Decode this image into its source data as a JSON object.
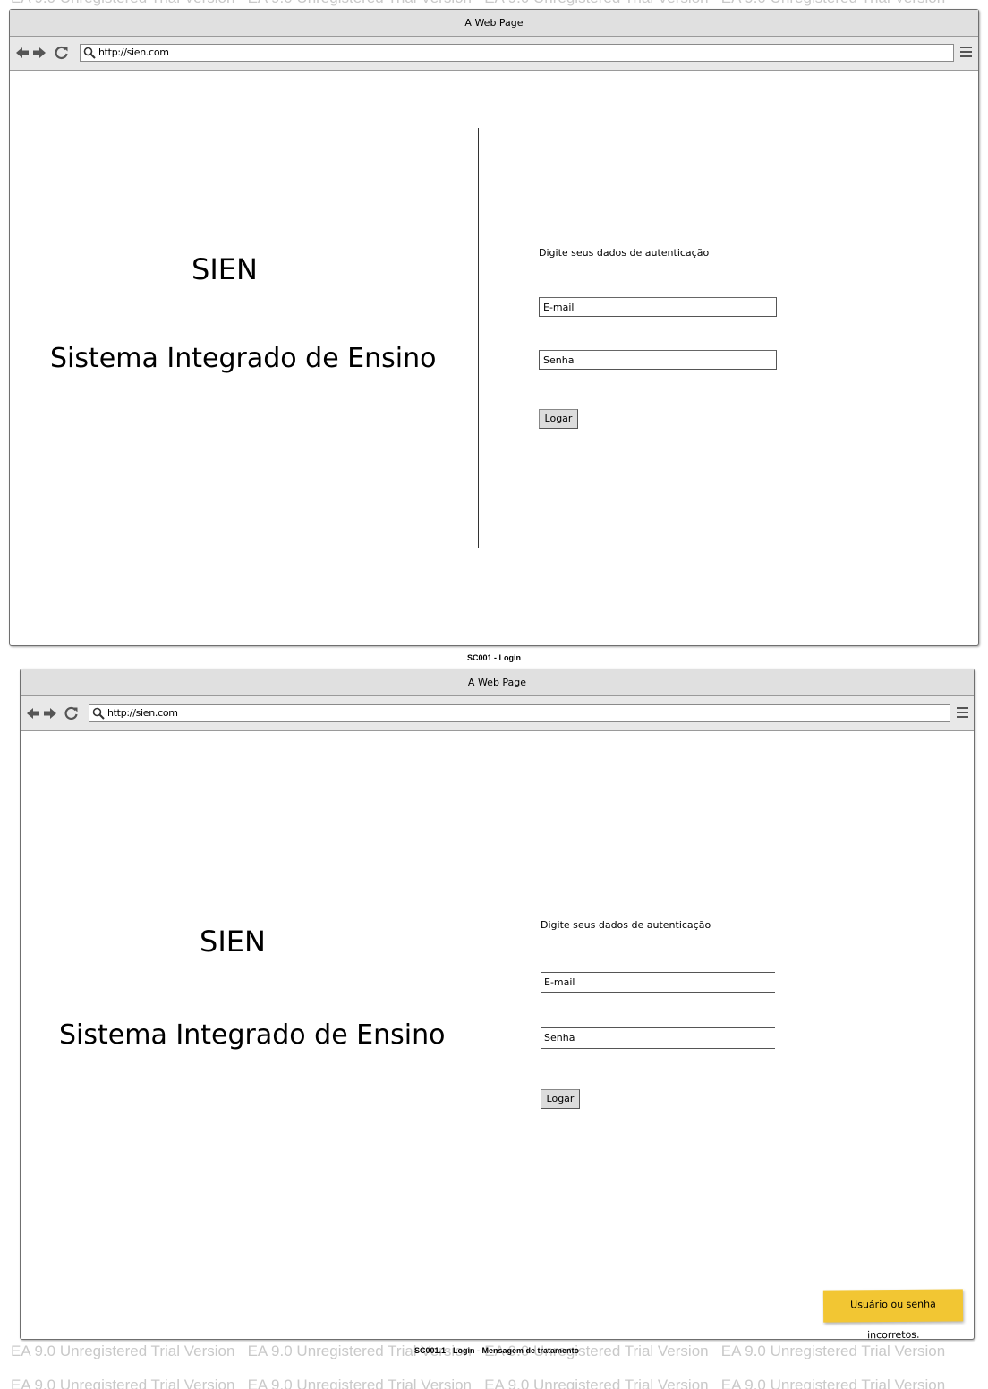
{
  "watermark": "EA 9.0 Unregistered Trial Version",
  "screens": [
    {
      "window_title": "A Web Page",
      "url": "http://sien.com",
      "app_name": "SIEN",
      "app_full_name": "Sistema Integrado de Ensino",
      "prompt": "Digite seus dados de autenticação",
      "email_label": "E-mail",
      "password_label": "Senha",
      "login_button": "Logar",
      "caption": "SC001 - Login"
    },
    {
      "window_title": "A Web Page",
      "url": "http://sien.com",
      "app_name": "SIEN",
      "app_full_name": "Sistema Integrado de Ensino",
      "prompt": "Digite seus dados de autenticação",
      "email_label": "E-mail",
      "password_label": "Senha",
      "login_button": "Logar",
      "error_message": "Usuário ou senha incorretos.",
      "caption": "SC001.1 - Login - Mensagem de tratamento"
    }
  ],
  "colors": {
    "toast_background": "#f2c633",
    "watermark": "#c9c9c9"
  }
}
